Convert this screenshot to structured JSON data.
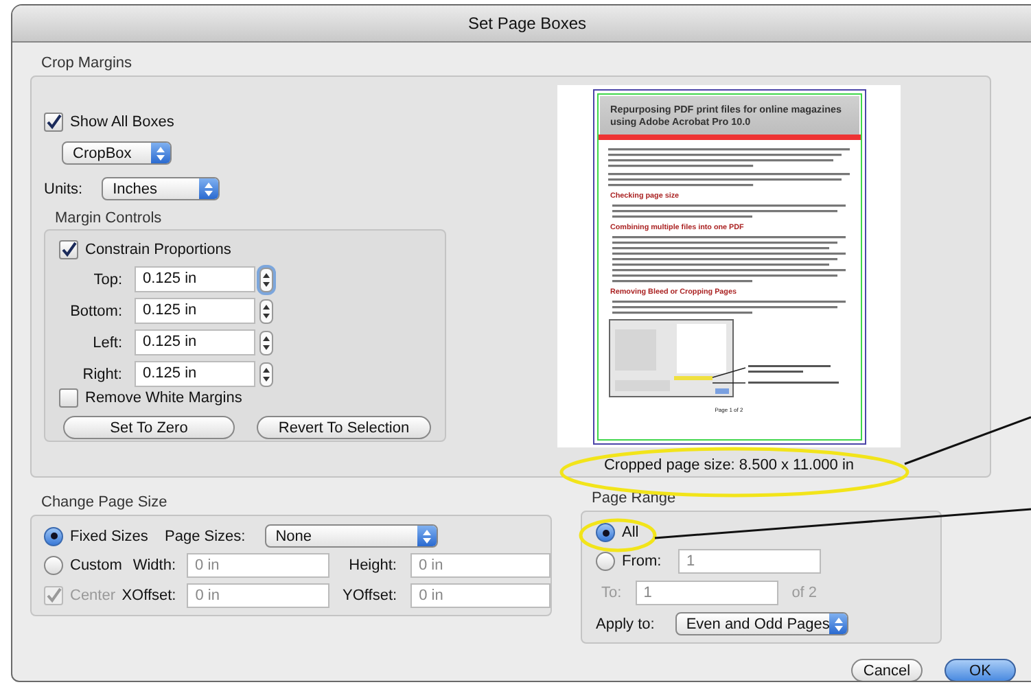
{
  "window": {
    "title": "Set Page Boxes"
  },
  "crop_margins": {
    "title": "Crop Margins",
    "show_all_boxes": {
      "label": "Show All Boxes",
      "checked": true
    },
    "box_popup": {
      "value": "CropBox"
    },
    "units": {
      "label": "Units:",
      "value": "Inches"
    },
    "margin_controls": {
      "title": "Margin Controls",
      "constrain": {
        "label": "Constrain Proportions",
        "checked": true
      },
      "fields": [
        {
          "label": "Top:",
          "value": "0.125 in",
          "focused": true
        },
        {
          "label": "Bottom:",
          "value": "0.125 in",
          "focused": false
        },
        {
          "label": "Left:",
          "value": "0.125 in",
          "focused": false
        },
        {
          "label": "Right:",
          "value": "0.125 in",
          "focused": false
        }
      ],
      "remove_white_margins": {
        "label": "Remove White Margins",
        "checked": false
      },
      "buttons": [
        "Set To Zero",
        "Revert To Selection"
      ]
    },
    "preview": {
      "document_title": "Repurposing PDF print files for online magazines using Adobe Acrobat Pro 10.0",
      "headings": [
        "Checking page size",
        "Combining multiple files into one PDF",
        "Removing Bleed or Cropping Pages"
      ],
      "footer": "Page 1 of 2",
      "caption": "Cropped page size: 8.500 x 11.000 in"
    }
  },
  "change_page_size": {
    "title": "Change Page Size",
    "options": [
      {
        "label": "Fixed Sizes",
        "selected": true
      },
      {
        "label": "Custom",
        "selected": false
      }
    ],
    "page_sizes": {
      "label": "Page Sizes:",
      "value": "None"
    },
    "fields": [
      {
        "label": "Width:",
        "value": "0 in"
      },
      {
        "label": "Height:",
        "value": "0 in"
      },
      {
        "label": "XOffset:",
        "value": "0 in"
      },
      {
        "label": "YOffset:",
        "value": "0 in"
      }
    ],
    "center": {
      "label": "Center",
      "checked": true,
      "disabled": true
    }
  },
  "page_range": {
    "title": "Page Range",
    "options": [
      {
        "label": "All",
        "selected": true
      },
      {
        "label": "From:",
        "selected": false
      }
    ],
    "from": {
      "value": "1"
    },
    "to": {
      "label": "To:",
      "value": "1",
      "disabled": true
    },
    "of": "of 2",
    "apply_to": {
      "label": "Apply to:",
      "value": "Even and Odd Pages"
    }
  },
  "buttons": [
    {
      "label": "Cancel",
      "default": false
    },
    {
      "label": "OK",
      "default": true
    }
  ]
}
